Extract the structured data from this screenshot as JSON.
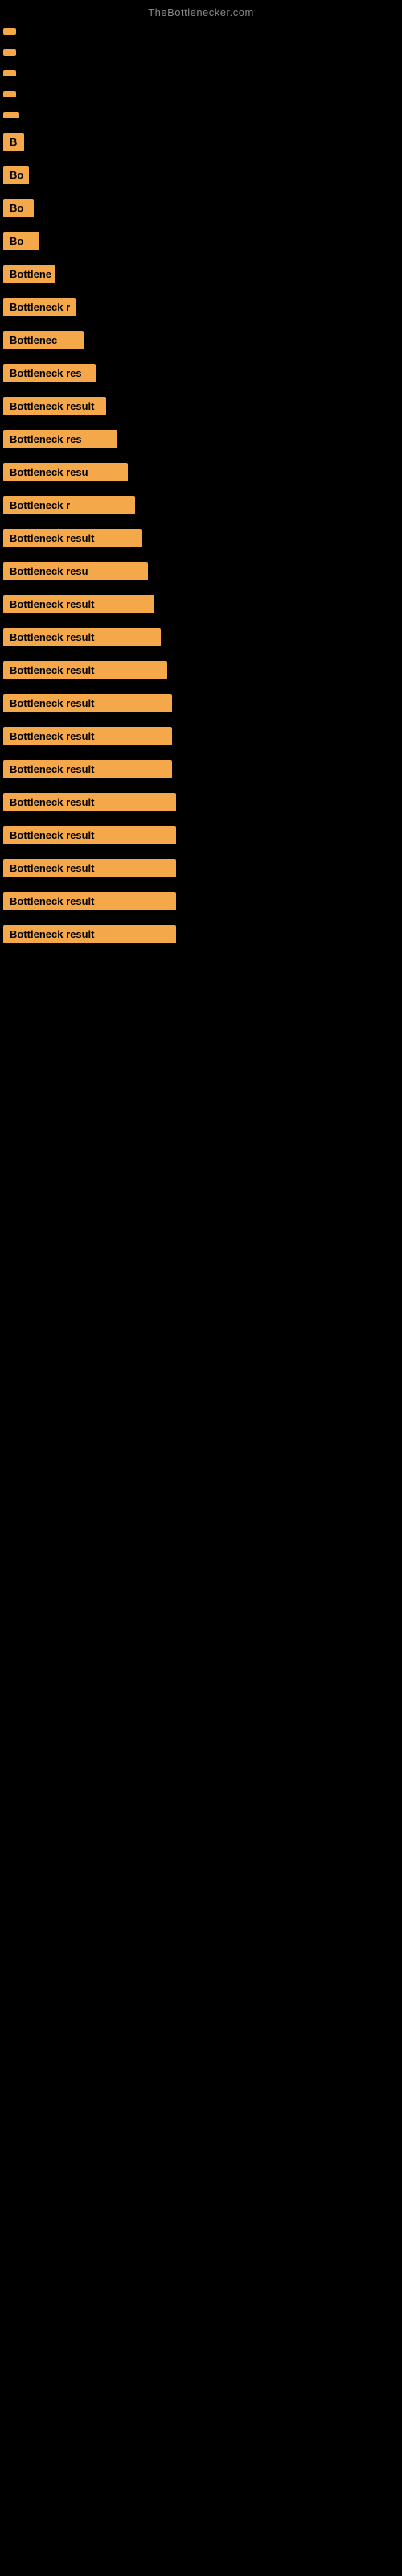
{
  "site": {
    "title": "TheBottlenecker.com"
  },
  "items": [
    {
      "id": 1,
      "label": ""
    },
    {
      "id": 2,
      "label": ""
    },
    {
      "id": 3,
      "label": ""
    },
    {
      "id": 4,
      "label": ""
    },
    {
      "id": 5,
      "label": ""
    },
    {
      "id": 6,
      "label": "B"
    },
    {
      "id": 7,
      "label": "Bo"
    },
    {
      "id": 8,
      "label": "Bo"
    },
    {
      "id": 9,
      "label": "Bo"
    },
    {
      "id": 10,
      "label": "Bottlene"
    },
    {
      "id": 11,
      "label": "Bottleneck r"
    },
    {
      "id": 12,
      "label": "Bottlenec"
    },
    {
      "id": 13,
      "label": "Bottleneck res"
    },
    {
      "id": 14,
      "label": "Bottleneck result"
    },
    {
      "id": 15,
      "label": "Bottleneck res"
    },
    {
      "id": 16,
      "label": "Bottleneck resu"
    },
    {
      "id": 17,
      "label": "Bottleneck r"
    },
    {
      "id": 18,
      "label": "Bottleneck result"
    },
    {
      "id": 19,
      "label": "Bottleneck resu"
    },
    {
      "id": 20,
      "label": "Bottleneck result"
    },
    {
      "id": 21,
      "label": "Bottleneck result"
    },
    {
      "id": 22,
      "label": "Bottleneck result"
    },
    {
      "id": 23,
      "label": "Bottleneck result"
    },
    {
      "id": 24,
      "label": "Bottleneck result"
    },
    {
      "id": 25,
      "label": "Bottleneck result"
    },
    {
      "id": 26,
      "label": "Bottleneck result"
    },
    {
      "id": 27,
      "label": "Bottleneck result"
    },
    {
      "id": 28,
      "label": "Bottleneck result"
    },
    {
      "id": 29,
      "label": "Bottleneck result"
    },
    {
      "id": 30,
      "label": "Bottleneck result"
    }
  ]
}
